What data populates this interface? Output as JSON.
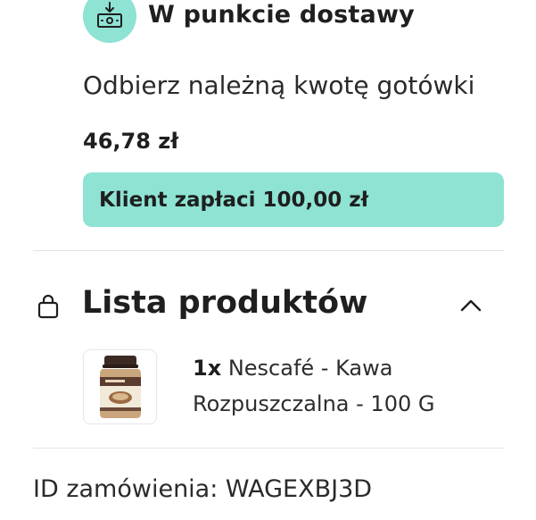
{
  "payment": {
    "icon": "cash-download-icon",
    "title": "W punkcie dostawy",
    "instruction": "Odbierz należną kwotę gotówki",
    "amount": "46,78 zł",
    "client_pays": "Klient zapłaci 100,00 zł",
    "accent_color": "#8ee3d3"
  },
  "products": {
    "icon": "shopping-bag-icon",
    "title": "Lista produktów",
    "toggle_icon": "chevron-up-icon",
    "items": [
      {
        "quantity": "1x",
        "name_line1": "Nescafé - Kawa",
        "name_line2": "Rozpuszczalna - 100 G",
        "image": "nescafe-jar"
      }
    ]
  },
  "order": {
    "id_text": "ID zamówienia: WAGEXBJ3D"
  }
}
